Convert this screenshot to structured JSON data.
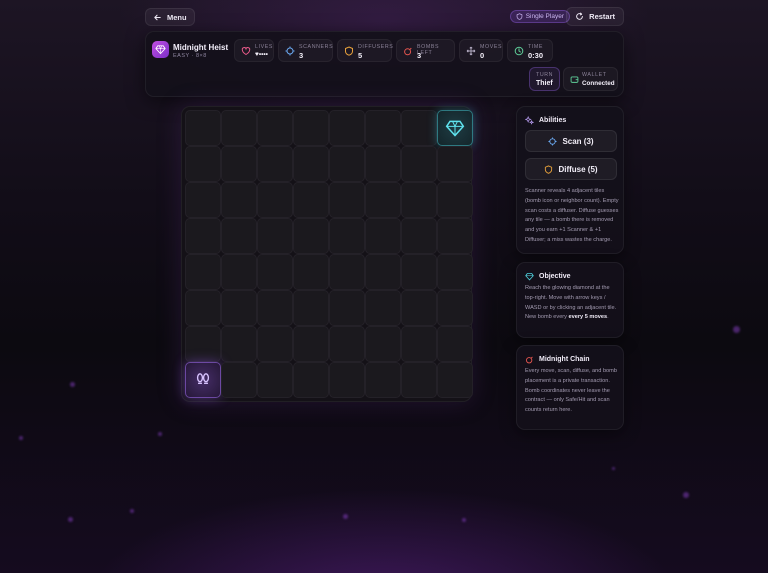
{
  "topbar": {
    "menu_label": "Menu",
    "mode_label": "Single Player",
    "restart_label": "Restart"
  },
  "header": {
    "title": "Midnight Heist",
    "subtitle": "EASY · 8×8",
    "lives": {
      "label": "LIVES",
      "value": "♥••••"
    },
    "scanners": {
      "label": "SCANNERS",
      "value": "3"
    },
    "diffusers": {
      "label": "DIFFUSERS",
      "value": "5"
    },
    "bombs_left": {
      "label": "BOMBS LEFT",
      "value": "3"
    },
    "moves": {
      "label": "MOVES",
      "value": "0"
    },
    "time": {
      "label": "TIME",
      "value": "0:30"
    },
    "turn": {
      "label": "TURN",
      "value": "Thief"
    },
    "wallet": {
      "label": "WALLET",
      "value": "Connected"
    }
  },
  "board": {
    "rows": 8,
    "cols": 8,
    "goal_tile": {
      "row": 0,
      "col": 7,
      "icon": "diamond-icon"
    },
    "player_tile": {
      "row": 7,
      "col": 0,
      "icon": "footprints-icon"
    }
  },
  "abilities": {
    "title": "Abilities",
    "scan_label": "Scan (3)",
    "diffuse_label": "Diffuse (5)",
    "description": "Scanner reveals 4 adjacent tiles (bomb icon or neighbor count). Empty scan costs a diffuser. Diffuse guesses any tile — a bomb there is removed and you earn +1 Scanner & +1 Diffuser; a miss wastes the charge."
  },
  "objective": {
    "title": "Objective",
    "text_main": "Reach the glowing diamond at the top-right. Move with arrow keys / WASD or by clicking an adjacent tile. New bomb every ",
    "text_bold": "every 5 moves",
    "text_end": "."
  },
  "chain": {
    "title": "Midnight Chain",
    "text": "Every move, scan, diffuse, and bomb placement is a private transaction. Bomb coordinates never leave the contract — only Safe/Hit and scan counts return here."
  },
  "colors": {
    "accent_purple": "#9b5de5",
    "gem_cyan": "#4fd1dd",
    "lives_pink": "#e85a8a",
    "scanner_blue": "#6aa8f0",
    "diffuser_orange": "#e9a23b",
    "bomb_red": "#e5554f",
    "time_green": "#5fcf9a"
  }
}
